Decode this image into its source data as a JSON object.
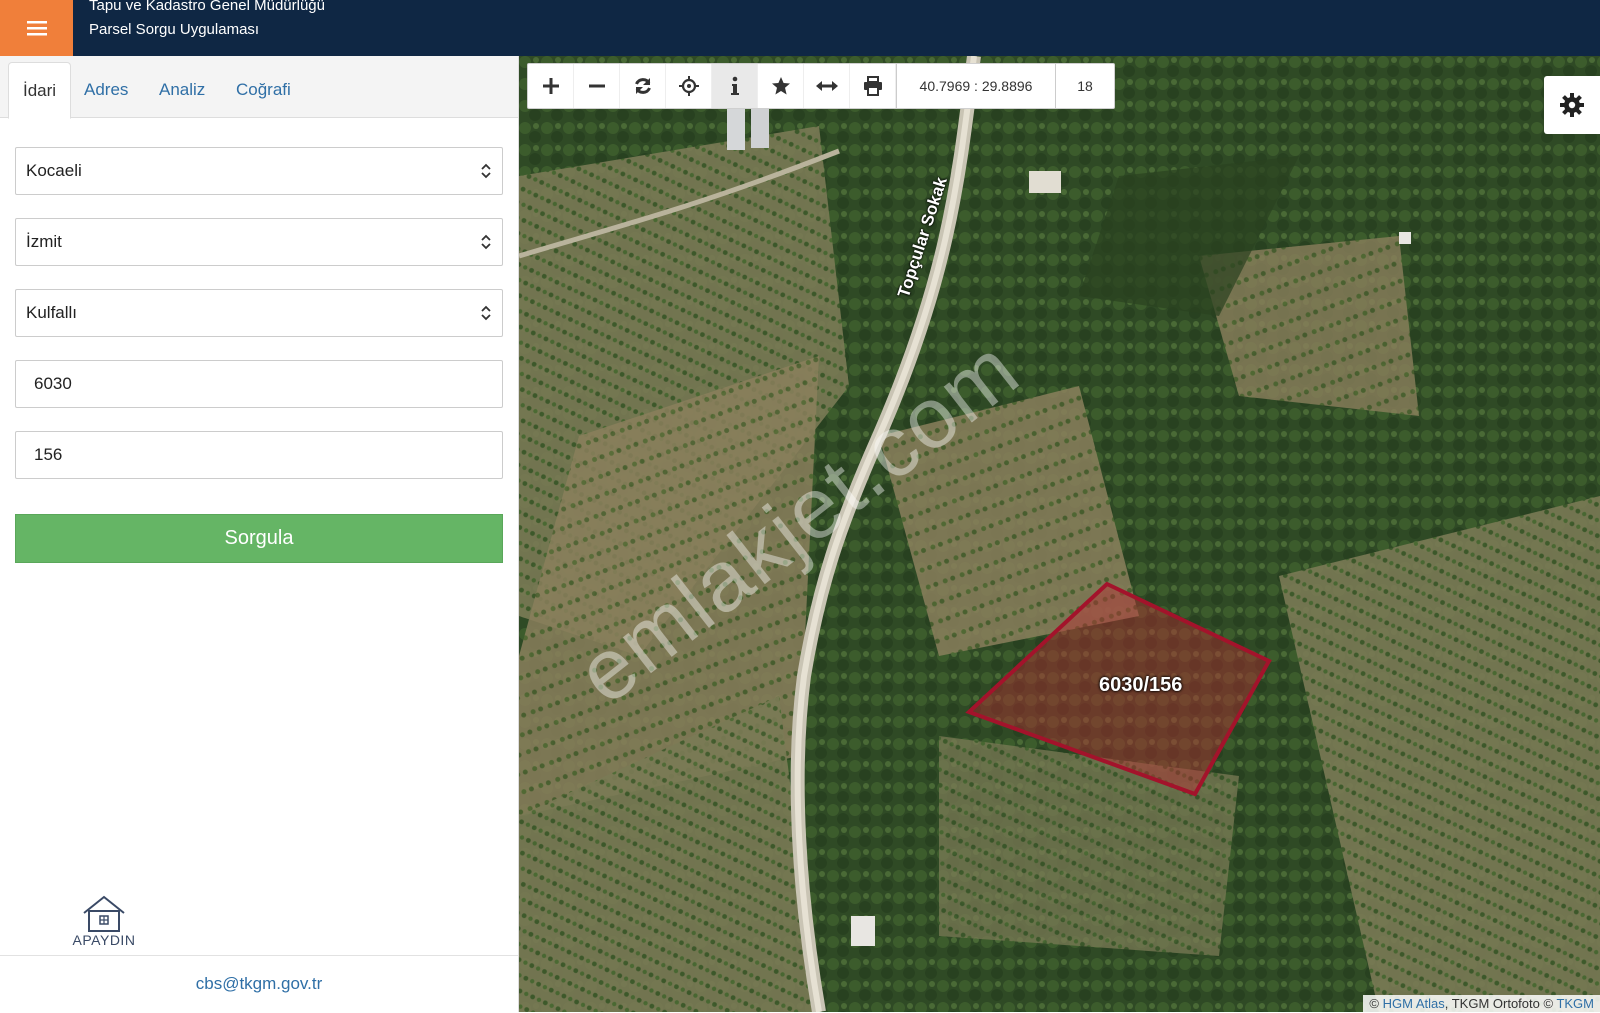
{
  "header": {
    "line1": "Tapu ve Kadastro Genel Müdürlüğü",
    "line2": "Parsel Sorgu Uygulaması"
  },
  "tabs": [
    {
      "label": "İdari"
    },
    {
      "label": "Adres"
    },
    {
      "label": "Analiz"
    },
    {
      "label": "Coğrafi"
    }
  ],
  "form": {
    "il": "Kocaeli",
    "ilce": "İzmit",
    "mahalle": "Kulfallı",
    "ada": "6030",
    "parsel": "156",
    "submit_label": "Sorgula"
  },
  "footer": {
    "email": "cbs@tkgm.gov.tr",
    "logo_text": "APAYDIN"
  },
  "toolbar": {
    "coordinates": "40.7969 : 29.8896",
    "zoom_level": "18",
    "icons": [
      "zoom-in-icon",
      "zoom-out-icon",
      "refresh-icon",
      "locate-icon",
      "info-icon",
      "favorite-icon",
      "measure-icon",
      "print-icon"
    ]
  },
  "map": {
    "street_label": "Topçular Sokak",
    "parcel_label": "6030/156",
    "watermark": "emlakjet.com",
    "attribution": {
      "prefix": "© ",
      "hgm": "HGM Atlas",
      "middle": ", TKGM Ortofoto © ",
      "tkgm": "TKGM"
    },
    "parcel_color": "#a3132b"
  },
  "colors": {
    "header_bg": "#0f2744",
    "menu_accent": "#f07f3a",
    "submit_green": "#65b565",
    "link_blue": "#2f6fa6"
  }
}
